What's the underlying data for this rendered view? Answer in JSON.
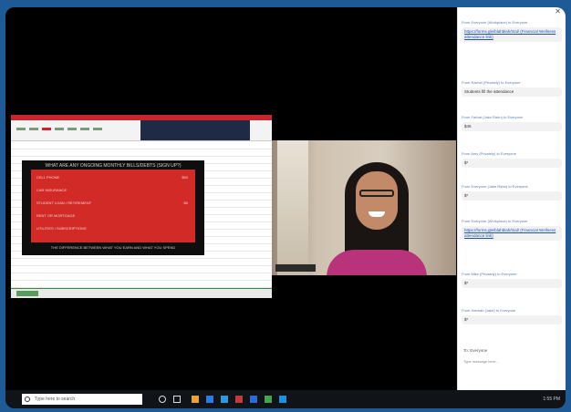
{
  "taskbar": {
    "search_placeholder": "Type here to search",
    "clock_time": "1:55 PM",
    "icon_colors": [
      "#e8a23b",
      "#2d7be0",
      "#2a9ad8",
      "#c23a3a",
      "#2b6bd6",
      "#48a34f",
      "#1e90e0"
    ]
  },
  "slide": {
    "heading": "WHAT ARE ANY ONGOING MONTHLY BILLS/DEBTS (SIGN UP?)",
    "lines": [
      {
        "label": "CELL PHONE",
        "value": "$50"
      },
      {
        "label": "CAR INSURANCE",
        "value": ""
      },
      {
        "label": "STUDENT LOAN / RETIREMENT",
        "value": "$0"
      },
      {
        "label": "RENT OR MORTGAGE",
        "value": ""
      },
      {
        "label": "UTILITIES / SUBSCRIPTIONS",
        "value": ""
      }
    ],
    "footer": "THE DIFFERENCE BETWEEN WHAT YOU EARN AND WHAT YOU SPEND"
  },
  "chat": {
    "messages": [
      {
        "who": "From Everyone (Workplace) to Everyone",
        "text": "https://forms.gle/blahblah/trial/ (Financial Wellness attendance link)",
        "link": true
      },
      {
        "who": "From Rachel (Privately) to Everyone",
        "text": "Students fill the attendance",
        "link": false
      },
      {
        "who": "From Farhat (Jake Rahn) to Everyone",
        "text": "$45",
        "link": false
      },
      {
        "who": "From Amy (Privately) to Everyone",
        "text": "$*",
        "link": false
      },
      {
        "who": "From Everyone (Jake Rahn) to Everyone",
        "text": "$*",
        "link": false
      },
      {
        "who": "From Everyone (Workplace) to Everyone",
        "text": "https://forms.gle/blahblah/trial/ (Financial Wellness attendance link)",
        "link": true
      },
      {
        "who": "From Mike (Privately) to Everyone",
        "text": "$*",
        "link": false
      },
      {
        "who": "From Hannah (Jake) to Everyone",
        "text": "$*",
        "link": false
      }
    ],
    "footer_to": "To: Everyone",
    "footer_hint": "Type message here..."
  }
}
